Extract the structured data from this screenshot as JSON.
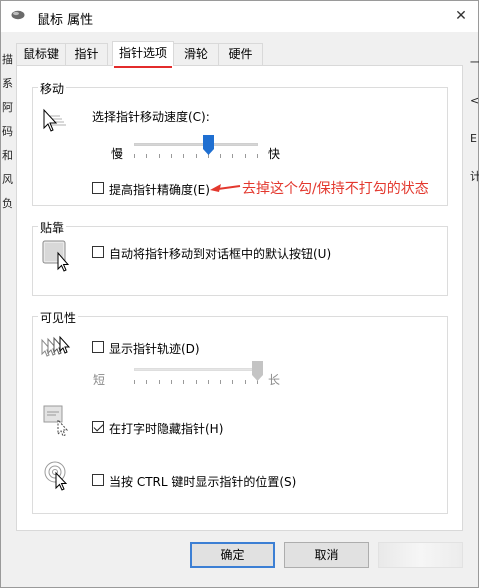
{
  "window": {
    "title": "鼠标 属性",
    "close_glyph": "✕"
  },
  "background": {
    "left_chars": [
      "描",
      "系",
      "阿",
      "码",
      "和",
      "风",
      "负"
    ],
    "right_chars": [
      "一",
      "<",
      "E",
      "计"
    ]
  },
  "tabs": [
    {
      "label": "鼠标键",
      "active": false
    },
    {
      "label": "指针",
      "active": false
    },
    {
      "label": "指针选项",
      "active": true
    },
    {
      "label": "滑轮",
      "active": false
    },
    {
      "label": "硬件",
      "active": false
    }
  ],
  "motion": {
    "group_label": "移动",
    "speed_label": "选择指针移动速度(C):",
    "slow_label": "慢",
    "fast_label": "快",
    "speed_value": 6,
    "speed_max": 10,
    "precision_label": "提高指针精确度(E)",
    "precision_checked": false,
    "icon": "pointer-speed-icon"
  },
  "snap": {
    "group_label": "贴靠",
    "snap_label": "自动将指针移动到对话框中的默认按钮(U)",
    "snap_checked": false,
    "icon": "snap-to-icon"
  },
  "visibility": {
    "group_label": "可见性",
    "trails_label": "显示指针轨迹(D)",
    "trails_checked": false,
    "short_label": "短",
    "long_label": "长",
    "trails_value": 10,
    "trails_max": 10,
    "hide_label": "在打字时隐藏指针(H)",
    "hide_checked": true,
    "ctrl_label": "当按 CTRL 键时显示指针的位置(S)",
    "ctrl_checked": false,
    "icons": [
      "pointer-trails-icon",
      "hide-pointer-icon",
      "ctrl-locate-icon"
    ]
  },
  "annotation": {
    "text": "去掉这个勾/保持不打勾的状态",
    "color": "#e3382e"
  },
  "buttons": {
    "ok": "确定",
    "cancel": "取消",
    "apply": ""
  },
  "colors": {
    "accent": "#3c7fd4",
    "tab_highlight": "#e32b2b",
    "slider_thumb": "#1f6fd1"
  }
}
